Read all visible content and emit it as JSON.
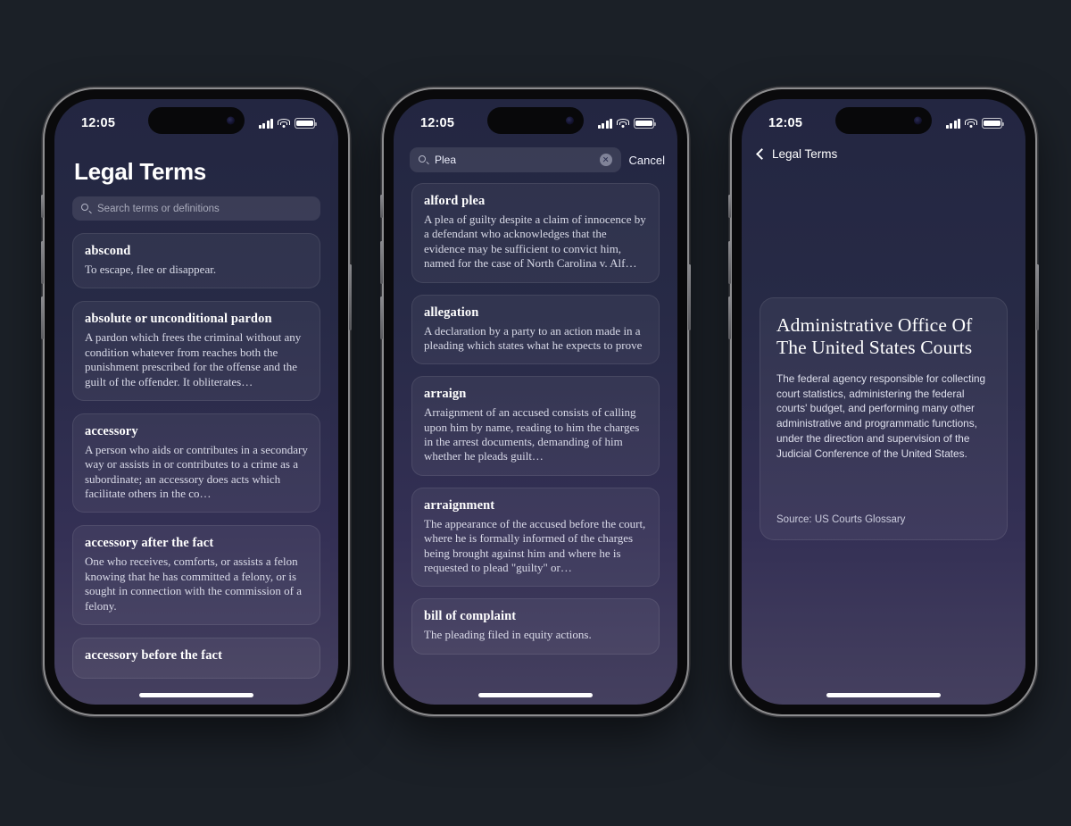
{
  "page": {
    "background_color": "#1b2027",
    "screen_gradient_top": "#232641",
    "screen_gradient_bottom": "#45405f"
  },
  "status_bar": {
    "time": "12:05",
    "cellular_icon": "signal-bars-icon",
    "wifi_icon": "wifi-icon",
    "battery_icon": "battery-icon"
  },
  "phone1": {
    "title": "Legal Terms",
    "search": {
      "placeholder": "Search terms or definitions",
      "icon": "search-icon"
    },
    "entries": [
      {
        "term": "abscond",
        "definition": "To escape, flee or disappear."
      },
      {
        "term": "absolute or unconditional pardon",
        "definition": "A pardon which frees the criminal without any condition whatever from reaches both the punishment prescribed for the offense and the guilt of the offender. It obliterates…"
      },
      {
        "term": "accessory",
        "definition": "A person who aids or contributes in a secondary way or assists in or contributes to a crime as a subordinate; an accessory does acts which facilitate others in the co…"
      },
      {
        "term": "accessory after the fact",
        "definition": "One who receives, comforts, or assists a felon knowing that he has committed a felony, or is sought in connection with the commission of a felony."
      },
      {
        "term": "accessory before the fact",
        "definition": ""
      }
    ]
  },
  "phone2": {
    "search": {
      "value": "Plea",
      "icon": "search-icon",
      "clear_icon": "clear-circle-icon",
      "cancel_label": "Cancel"
    },
    "results": [
      {
        "term": "alford plea",
        "definition": "A plea of guilty despite a claim of innocence by a defendant who acknowledges that the evidence may be sufficient to convict him, named for the case of North Carolina v. Alf…"
      },
      {
        "term": "allegation",
        "definition": "A declaration by a party to an action made in a pleading which states what he expects to prove"
      },
      {
        "term": "arraign",
        "definition": "Arraignment of an accused consists of calling upon him by name, reading to him the charges in the arrest documents, demanding of him whether he pleads guilt…"
      },
      {
        "term": "arraignment",
        "definition": "The appearance of the accused before the court, where he is formally informed of the charges being brought against him and where he is requested to plead \"guilty\" or…"
      },
      {
        "term": "bill of complaint",
        "definition": "The pleading filed in equity actions."
      }
    ]
  },
  "phone3": {
    "back_label": "Legal Terms",
    "back_icon": "chevron-left-icon",
    "detail": {
      "title": "Administrative Office Of The United States Courts",
      "body": "The federal agency responsible for collecting court statistics, administering the federal courts' budget, and performing many other administrative and programmatic functions, under the direction and supervision of the Judicial Conference of the United States.",
      "source": "Source: US Courts Glossary"
    }
  }
}
